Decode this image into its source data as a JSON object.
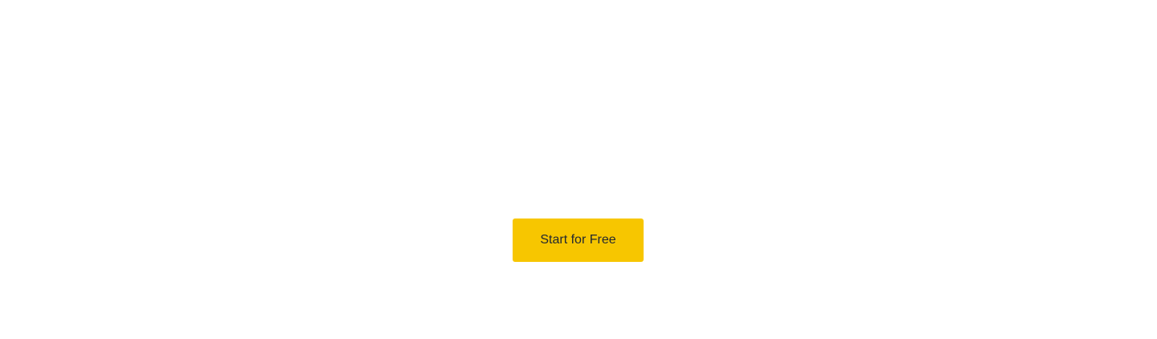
{
  "cta": {
    "label": "Start for Free",
    "background_color": "#f7c600",
    "text_color": "#222831"
  },
  "page": {
    "background_color": "#ffffff"
  }
}
